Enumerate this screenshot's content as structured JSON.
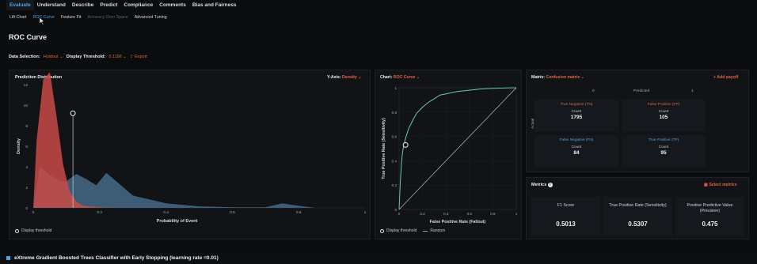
{
  "topnav": [
    "Evaluate",
    "Understand",
    "Describe",
    "Predict",
    "Compliance",
    "Comments",
    "Bias and Fairness"
  ],
  "subnav": [
    "Lift Chart",
    "ROC Curve",
    "Feature Fit",
    "Accuracy Over Space",
    "Advanced Tuning"
  ],
  "page_title": "ROC Curve",
  "data_selection": {
    "label": "Data Selection:",
    "value": "Holdout",
    "threshold_label": "Display Threshold:",
    "threshold_value": "0.1196",
    "export": "Export"
  },
  "dist_panel": {
    "title": "Prediction Distribution",
    "yaxis_label": "Y-Axis:",
    "yaxis_value": "Density",
    "ylabel": "Density",
    "xlabel": "Probability of Event",
    "yticks": [
      "0",
      "2",
      "4",
      "6",
      "8",
      "10",
      "12"
    ],
    "xticks": [
      "0",
      "0.2",
      "0.4",
      "0.6",
      "0.8",
      "1"
    ],
    "legend": "Display threshold"
  },
  "roc_panel": {
    "chart_label": "Chart:",
    "chart_value": "ROC Curve",
    "ylabel": "True Positive Rate (Sensitivity)",
    "xlabel": "False Positive Rate (Fallout)",
    "ticks": [
      "0",
      "0.2",
      "0.4",
      "0.6",
      "0.8",
      "1"
    ],
    "legend_threshold": "Display threshold",
    "legend_random": "Random"
  },
  "matrix_panel": {
    "label": "Matrix:",
    "value": "Confusion matrix",
    "add": "Add payoff",
    "predicted": "Predicted",
    "actual": "Actual",
    "pred0": "0",
    "pred1": "1",
    "act0": "0",
    "act1": "1",
    "cells": [
      {
        "name": "True Negative (TN)",
        "count_label": "Count",
        "count": "1795",
        "color": "#e0643f"
      },
      {
        "name": "False Positive (FP)",
        "count_label": "Count",
        "count": "105",
        "color": "#e0643f"
      },
      {
        "name": "False Negative (FN)",
        "count_label": "Count",
        "count": "84",
        "color": "#4fa3e0"
      },
      {
        "name": "True Positive (TP)",
        "count_label": "Count",
        "count": "95",
        "color": "#4fa3e0"
      }
    ]
  },
  "metrics_panel": {
    "title": "Metrics",
    "select": "Select metrics",
    "items": [
      {
        "label": "F1 Score",
        "value": "0.5013"
      },
      {
        "label": "True Positive Rate (Sensitivity)",
        "value": "0.5307"
      },
      {
        "label": "Positive Predictive Value (Precision)",
        "value": "0.475"
      }
    ]
  },
  "bottom_title": "eXtreme Gradient Boosted Trees Classifier with Early Stopping (learning rate =0.01)",
  "colors": {
    "accent": "#4fa3e0",
    "orange": "#e0643f",
    "red": "#c84a48",
    "blue": "#5b8db8",
    "teal": "#6cc6b4"
  },
  "chart_data": [
    {
      "type": "area",
      "title": "Prediction Distribution",
      "xlabel": "Probability of Event",
      "ylabel": "Density",
      "xlim": [
        0,
        1
      ],
      "ylim": [
        0,
        12
      ],
      "series": [
        {
          "x": [
            0,
            0.01,
            0.03,
            0.05,
            0.07,
            0.09,
            0.11,
            0.13,
            0.15,
            0.2,
            0.25,
            0.3
          ],
          "values": [
            0,
            6.5,
            12.5,
            13.2,
            9,
            4.2,
            1.6,
            0.6,
            0.2,
            0.05,
            0,
            0
          ]
        },
        {
          "x": [
            0,
            0.02,
            0.05,
            0.08,
            0.1,
            0.13,
            0.16,
            0.19,
            0.22,
            0.25,
            0.3,
            0.4,
            0.5,
            0.6,
            0.7,
            0.75,
            0.8,
            0.85
          ],
          "values": [
            0,
            4,
            3.2,
            2.6,
            2.6,
            3.3,
            2.8,
            2.2,
            3.4,
            2.6,
            1.2,
            0.45,
            0.15,
            0.05,
            0.05,
            0.45,
            0.2,
            0
          ]
        }
      ],
      "threshold": 0.1196
    },
    {
      "type": "line",
      "xlabel": "False Positive Rate (Fallout)",
      "ylabel": "True Positive Rate (Sensitivity)",
      "xlim": [
        0,
        1
      ],
      "ylim": [
        0,
        1
      ],
      "x": [
        0,
        0.01,
        0.02,
        0.03,
        0.04,
        0.06,
        0.08,
        0.1,
        0.12,
        0.15,
        0.2,
        0.25,
        0.3,
        0.35,
        0.4,
        0.5,
        0.6,
        0.7,
        0.8,
        0.9,
        1
      ],
      "y": [
        0,
        0.22,
        0.38,
        0.47,
        0.53,
        0.6,
        0.66,
        0.7,
        0.74,
        0.79,
        0.84,
        0.88,
        0.91,
        0.94,
        0.95,
        0.97,
        0.98,
        0.99,
        0.995,
        0.998,
        1
      ],
      "threshold_point": [
        0.055,
        0.53
      ]
    }
  ]
}
